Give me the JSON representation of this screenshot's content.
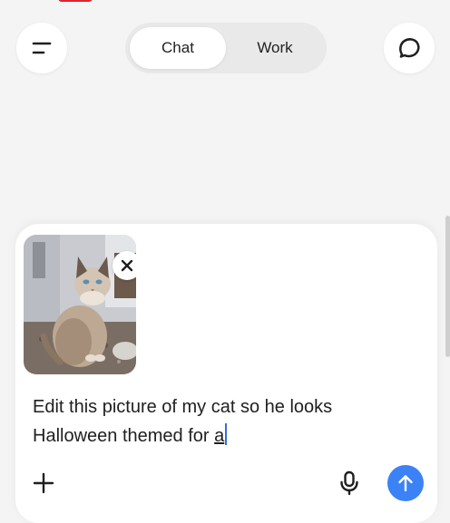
{
  "header": {
    "menu_icon": "menu-icon",
    "new_chat_icon": "new-chat-icon",
    "tabs": [
      {
        "label": "Chat",
        "selected": true
      },
      {
        "label": "Work",
        "selected": false
      }
    ]
  },
  "composer": {
    "attachment": {
      "icon": "cat-photo-thumbnail",
      "remove_icon": "close-icon"
    },
    "text_line1": "Edit this picture of my cat so he looks",
    "text_line2": "Halloween themed for ",
    "text_tail": "a",
    "add_icon": "plus-icon",
    "mic_icon": "microphone-icon",
    "send_icon": "arrow-up-icon"
  },
  "colors": {
    "background": "#f4f4f4",
    "surface": "#ffffff",
    "segment_track": "#e9e9e9",
    "accent": "#3b82f6",
    "caret": "#2f6fe4",
    "status_sliver": "#e0242c"
  }
}
